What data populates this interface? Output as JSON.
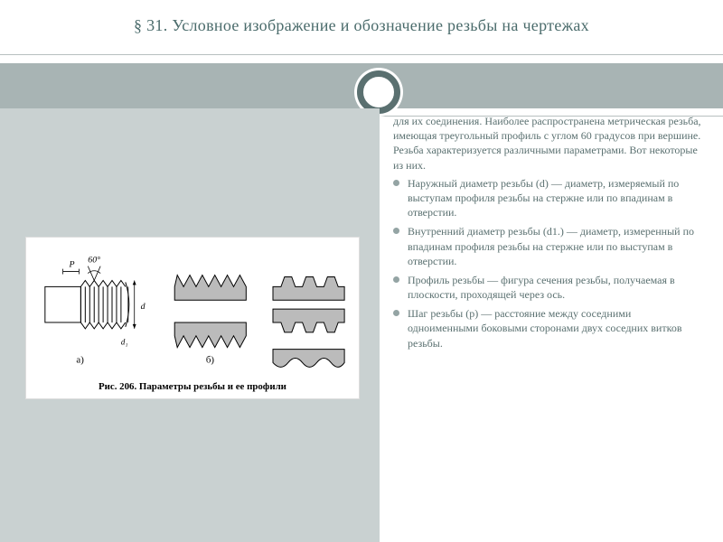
{
  "title": "§ 31. Условное изображение и обозначение резьбы на чертежах",
  "intro": "для их соединения. Наиболее распространена метрическая резьба, имеющая треугольный профиль с углом 60 градусов при вершине. Резьба характеризуется различными параметрами. Вот некоторые из них.",
  "bullets": [
    "Наружный диаметр резьбы (d) — диаметр, измеряемый по выступам профиля резьбы на стержне или по впадинам в отверстии.",
    "Внутренний диаметр резьбы (d1.) — диаметр, измеренный по впадинам профиля резьбы на стержне или по выступам в отверстии.",
    "Профиль резьбы — фигура сечения резьбы, получаемая в плоскости, проходящей через ось.",
    "Шаг резьбы (p) — расстояние между соседними одноименными боковыми сторонами двух соседних витков резьбы."
  ],
  "figure": {
    "caption": "Рис. 206. Параметры резьбы и ее профили",
    "labels": {
      "angle": "60°",
      "pitch": "P",
      "a": "а)",
      "b": "б)",
      "d": "d",
      "d1": "d₁"
    }
  }
}
